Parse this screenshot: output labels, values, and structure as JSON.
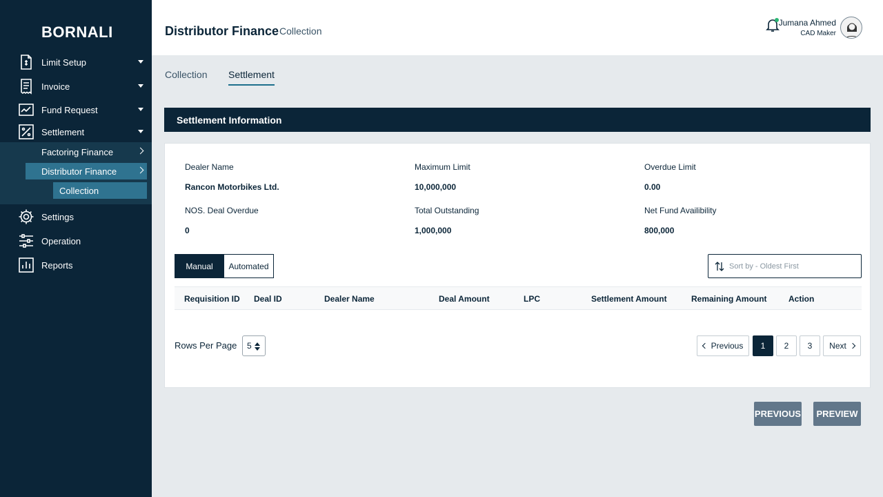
{
  "app": {
    "brand": "BORNALI"
  },
  "sidebar": {
    "items": [
      {
        "label": "Limit Setup",
        "icon": "document-icon"
      },
      {
        "label": "Invoice",
        "icon": "receipt-icon"
      },
      {
        "label": "Fund Request",
        "icon": "chart-line-icon"
      },
      {
        "label": "Settlement",
        "icon": "percent-icon"
      },
      {
        "label": "Settings",
        "icon": "gear-icon"
      },
      {
        "label": "Operation",
        "icon": "sliders-icon"
      },
      {
        "label": "Reports",
        "icon": "bar-chart-icon"
      }
    ],
    "submenu": {
      "factoring": "Factoring Finance",
      "distributor": "Distributor Finance",
      "collection": "Collection"
    }
  },
  "header": {
    "title": "Distributor Finance",
    "subtitle": "Collection",
    "user_name": "Jumana Ahmed",
    "user_role": "CAD Maker",
    "notification_color": "#2bb673"
  },
  "tabs": [
    {
      "label": "Collection",
      "active": false
    },
    {
      "label": "Settlement",
      "active": true
    }
  ],
  "section": {
    "title": "Settlement Information"
  },
  "info": {
    "dealer_name_label": "Dealer Name",
    "dealer_name_value": "Rancon Motorbikes Ltd.",
    "max_limit_label": "Maximum Limit",
    "max_limit_value": "10,000,000",
    "overdue_limit_label": "Overdue Limit",
    "overdue_limit_value": "0.00",
    "deal_overdue_label": "NOS. Deal Overdue",
    "deal_overdue_value": "0",
    "total_outstanding_label": "Total Outstanding",
    "total_outstanding_value": "1,000,000",
    "net_fund_label": "Net Fund Availibility",
    "net_fund_value": "800,000"
  },
  "mode": {
    "manual": "Manual",
    "automated": "Automated"
  },
  "sort": {
    "placeholder": "Sort by - Oldest First"
  },
  "table": {
    "columns": [
      "Requisition ID",
      "Deal ID",
      "Dealer Name",
      "Deal Amount",
      "LPC",
      "Settlement Amount",
      "Remaining Amount",
      "Action"
    ],
    "rows": []
  },
  "pagination": {
    "rows_per_page_label": "Rows Per Page",
    "rows_per_page": "5",
    "previous": "Previous",
    "next": "Next",
    "pages": [
      "1",
      "2",
      "3"
    ],
    "current": "1"
  },
  "actions": {
    "previous": "PREVIOUS",
    "preview": "PREVIEW"
  }
}
